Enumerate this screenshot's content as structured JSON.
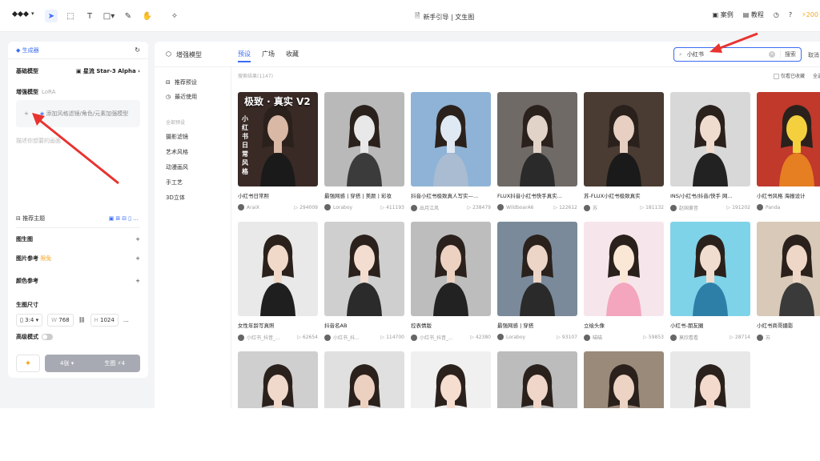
{
  "topbar": {
    "doc_title": "新手引导 | 文生图",
    "cases": "案例",
    "tutorial": "教程",
    "credits": "200"
  },
  "generator": {
    "title": "生成器",
    "base_model_label": "基础模型",
    "base_model_value": "星流 Star-3 Alpha",
    "enhance_label": "增强模型",
    "enhance_sub": "LoRA",
    "lora_add_text": "添加风格滤镜/角色/元素加强模型",
    "prompt_placeholder": "描述你想要的画面",
    "recommend_label": "推荐主题",
    "img2img_label": "图生图",
    "img_ref_label": "图片参考",
    "img_ref_tag": "限免",
    "color_ref_label": "颜色参考",
    "size_label": "生图尺寸",
    "ratio": "3:4",
    "width_prefix": "W",
    "width": "768",
    "height_prefix": "H",
    "height": "1024",
    "hd_label": "高级模式",
    "count": "4张",
    "generate": "生图",
    "generate_cost": "4"
  },
  "main": {
    "title": "增强模型",
    "tabs": [
      {
        "label": "预设"
      },
      {
        "label": "广场"
      },
      {
        "label": "收藏"
      }
    ],
    "search_value": "小红书",
    "search_button": "搜索",
    "cancel": "取消",
    "subnav": {
      "recommended": "推荐预设",
      "recent": "最近使用",
      "category_header": "全部预设",
      "categories": [
        "摄影滤镜",
        "艺术风格",
        "动漫画风",
        "手工艺",
        "3D立体"
      ]
    },
    "results_count": "搜索结果(1147)",
    "only_favorites": "仅看已收藏",
    "select_all": "全选"
  },
  "cards": [
    {
      "title": "小红书日常照",
      "author": "AraiX",
      "count": "294009",
      "banner": "极致 · 真实 V2",
      "vertical": "小红书日常风格"
    },
    {
      "title": "最强网感 | 穿搭 | 美颜 | 彩妆",
      "author": "Loraboy",
      "count": "411193"
    },
    {
      "title": "抖音小红书极致真人写实—...",
      "author": "出月江风",
      "count": "238479"
    },
    {
      "title": "FLUX抖音小红书快手真实...",
      "author": "WildboarA6",
      "count": "122612"
    },
    {
      "title": "苏-FLUX小红书极致真实",
      "author": "苏",
      "count": "181132"
    },
    {
      "title": "INS/小红书/抖音/快手 网...",
      "author": "赵国黄音",
      "count": "191202"
    },
    {
      "title": "小红书风格 海报设计",
      "author": "Panda",
      "count": ""
    },
    {
      "title": "女性年龄写真照",
      "author": "小红书_抖音_...",
      "count": "62654"
    },
    {
      "title": "抖音名AB",
      "author": "小红书_抖...",
      "count": "114700"
    },
    {
      "title": "控表情版",
      "author": "小红书_抖音_...",
      "count": "42380"
    },
    {
      "title": "最强网感 | 穿搭",
      "author": "Loraboy",
      "count": "93107"
    },
    {
      "title": "立绘头像",
      "author": "喵喵",
      "count": "59853"
    },
    {
      "title": "小红书-朋友圈",
      "author": "莫欣看看",
      "count": "28714"
    },
    {
      "title": "小红书商哥摄影",
      "author": "苏",
      "count": ""
    },
    {
      "title": "",
      "author": "",
      "count": ""
    },
    {
      "title": "",
      "author": "",
      "count": ""
    },
    {
      "title": "",
      "author": "",
      "count": ""
    },
    {
      "title": "",
      "author": "",
      "count": ""
    },
    {
      "title": "",
      "author": "",
      "count": ""
    },
    {
      "title": "",
      "author": "",
      "count": ""
    }
  ],
  "colors": {
    "accent": "#3a6cf4",
    "arrow": "#e8332f",
    "credit": "#f5a623"
  }
}
